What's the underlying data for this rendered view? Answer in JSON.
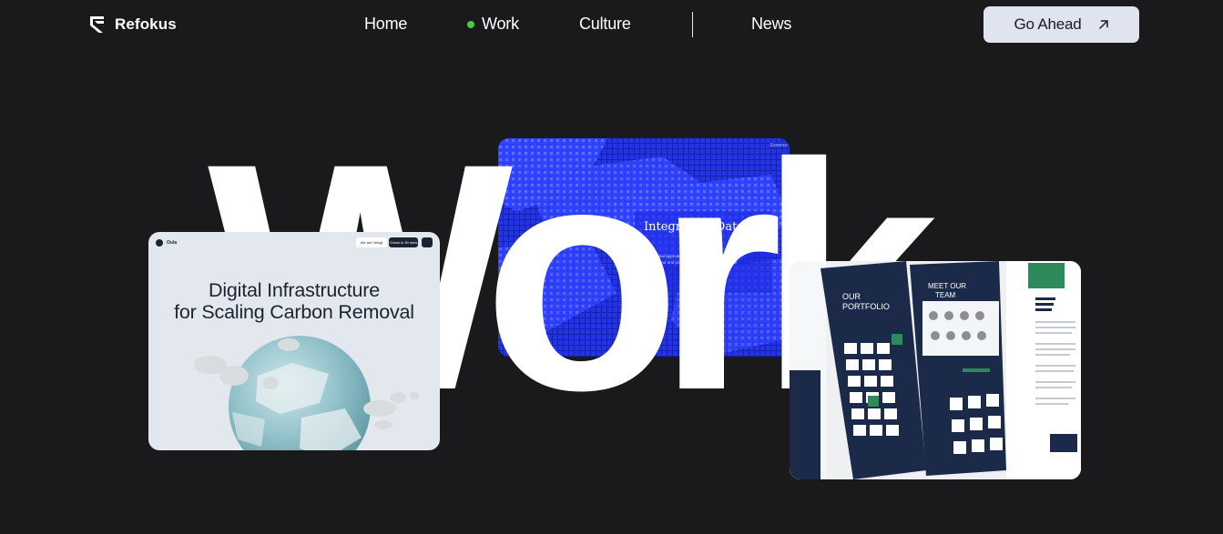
{
  "brand": {
    "name": "Refokus"
  },
  "nav": {
    "items": [
      "Home",
      "Work",
      "Culture",
      "News"
    ],
    "active": "Work"
  },
  "cta": {
    "label": "Go Ahead"
  },
  "hero": {
    "title": "Work"
  },
  "cards": {
    "carbon": {
      "brand": "Oula",
      "pill_a": "We are hiring!",
      "pill_b": "Check in 90 mins",
      "headline_line1": "Digital Infrastructure",
      "headline_line2": "for Scaling Carbon Removal"
    },
    "data": {
      "title": "Integrating Data",
      "corner": "Essence",
      "text": "Traditional approaches with data science to better understand and properties for long superformance"
    },
    "portfolio": {
      "portfolio_title": "OUR PORTFOLIO",
      "team_title": "MEET OUR TEAM",
      "side_heading": "On the US in emerging AI last Reflections on the rise"
    }
  },
  "colors": {
    "background": "#1a191b",
    "active_dot": "#3fd23c",
    "cta_bg": "#dfe4ee",
    "data_blue": "#1e2bd6",
    "portfolio_navy": "#1c2a4a",
    "accent_green": "#2d8a5b"
  },
  "icons": {
    "cta": "arrow-up-right-icon",
    "logo": "refokus-logo-icon"
  }
}
